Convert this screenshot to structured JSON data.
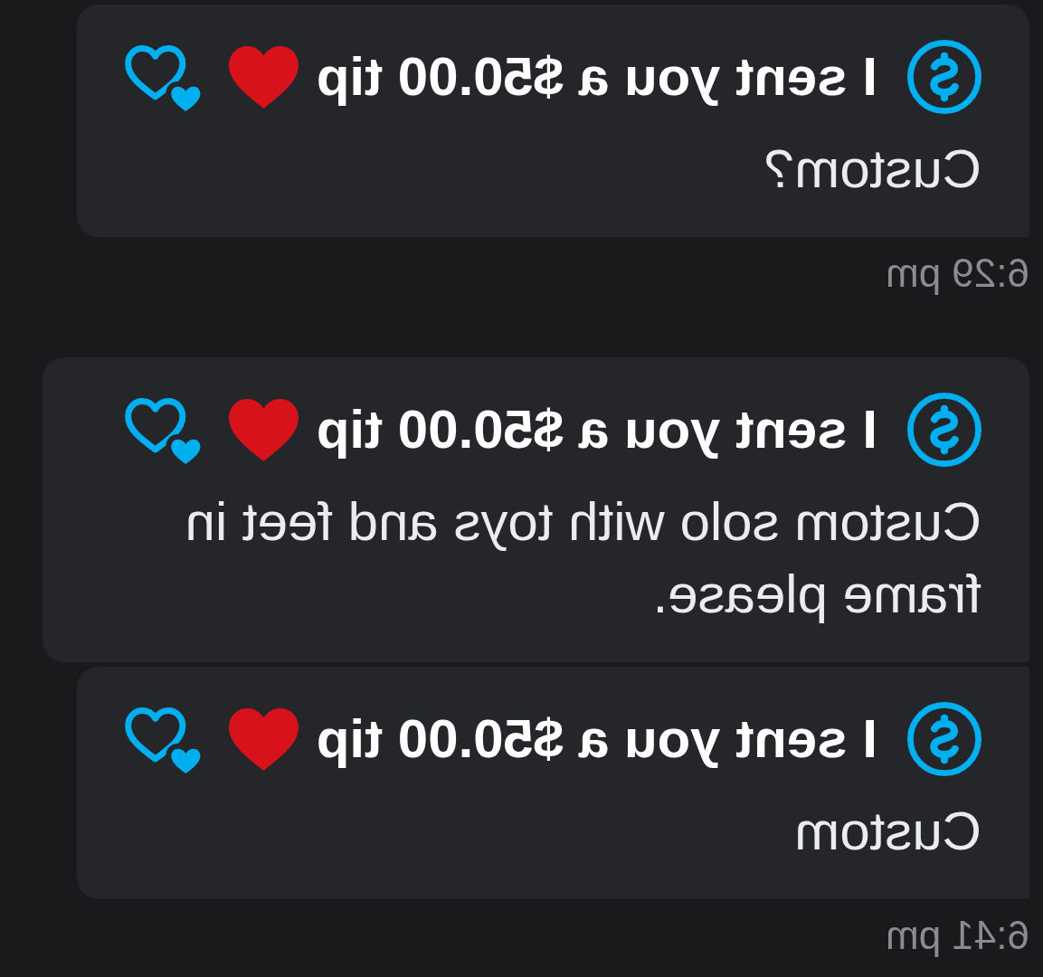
{
  "message_groups": [
    {
      "messages": [
        {
          "tip": "I sent you a $50.00 tip",
          "text": "Custom?"
        }
      ],
      "time": "6:29 pm"
    },
    {
      "messages": [
        {
          "tip": "I sent you a $50.00 tip",
          "text": "Custom solo with toys and feet in frame please."
        },
        {
          "tip": "I sent you a $50.00 tip",
          "text": "Custom"
        }
      ],
      "time": "6:41 pm"
    }
  ]
}
